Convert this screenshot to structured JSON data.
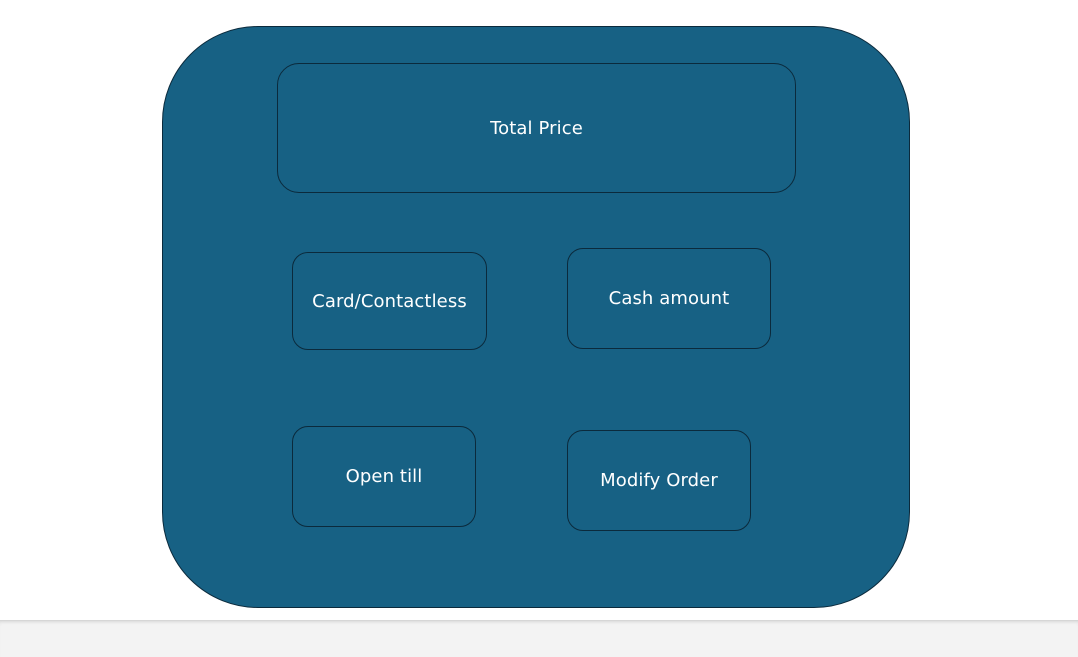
{
  "payment_panel": {
    "total_price_label": "Total Price",
    "buttons": {
      "card_contactless": "Card/Contactless",
      "cash_amount": "Cash amount",
      "open_till": "Open till",
      "modify_order": "Modify Order"
    }
  },
  "colors": {
    "panel_fill": "#176184",
    "outline": "#0b2a3c",
    "text": "#ffffff",
    "page_background": "#ffffff",
    "bottom_strip": "#f3f3f3"
  }
}
